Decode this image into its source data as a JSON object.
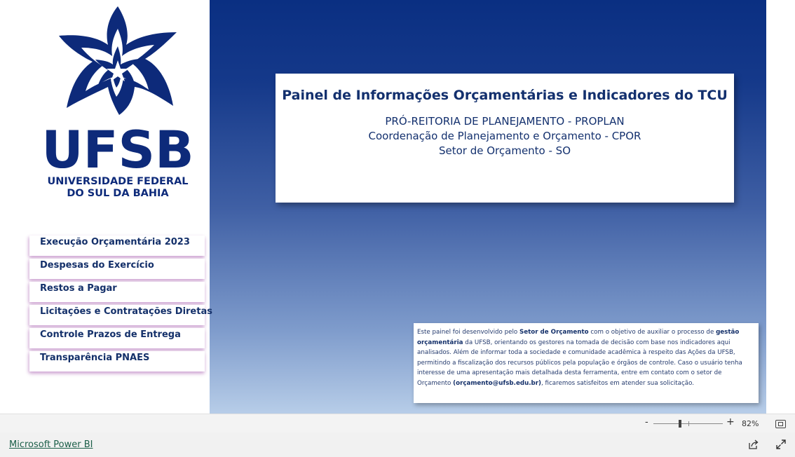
{
  "logo": {
    "acronym": "UFSB",
    "line1": "UNIVERSIDADE FEDERAL",
    "line2": "DO SUL DA BAHIA",
    "icon": "star-logo-icon",
    "color": "#0d2a7a"
  },
  "header": {
    "title": "Painel de Informações Orçamentárias e Indicadores do TCU",
    "line1": "PRÓ-REITORIA DE PLANEJAMENTO - PROPLAN",
    "line2": "Coordenação de Planejamento e Orçamento - CPOR",
    "line3": "Setor de Orçamento - SO"
  },
  "menu": {
    "items": [
      {
        "label": "Execução Orçamentária 2023"
      },
      {
        "label": "Despesas do Exercício"
      },
      {
        "label": "Restos a Pagar"
      },
      {
        "label": "Licitações e Contratações Diretas"
      },
      {
        "label": "Controle Prazos de Entrega"
      },
      {
        "label": "Transparência PNAES"
      }
    ]
  },
  "info": {
    "t1": "Este painel foi desenvolvido pelo ",
    "b1": "Setor de Orçamento",
    "t2": " com o objetivo de auxiliar o processo de ",
    "b2": "gestão orçamentária",
    "t3": " da UFSB, orientando os gestores na tomada de decisão com base nos indicadores aqui analisados. Além de informar toda a sociedade e comunidade acadêmica à respeito das Ações da UFSB, permitindo a fiscalização dos recursos públicos pela população e órgãos de controle. Caso o usuário tenha interesse de uma apresentação mais detalhada desta ferramenta, entre em contato com o setor de Orçamento ",
    "b3": "(orçamento@ufsb.edu.br)",
    "t4": ", ficaremos satisfeitos em atender sua solicitação."
  },
  "zoom": {
    "minus": "-",
    "plus": "+",
    "level": "82%"
  },
  "footer": {
    "link": "Microsoft Power BI",
    "share_icon": "share-icon",
    "expand_icon": "expand-icon"
  },
  "colors": {
    "navy": "#13306e",
    "gradient_top": "#0a2f82",
    "gradient_bottom": "#b7cde8"
  }
}
